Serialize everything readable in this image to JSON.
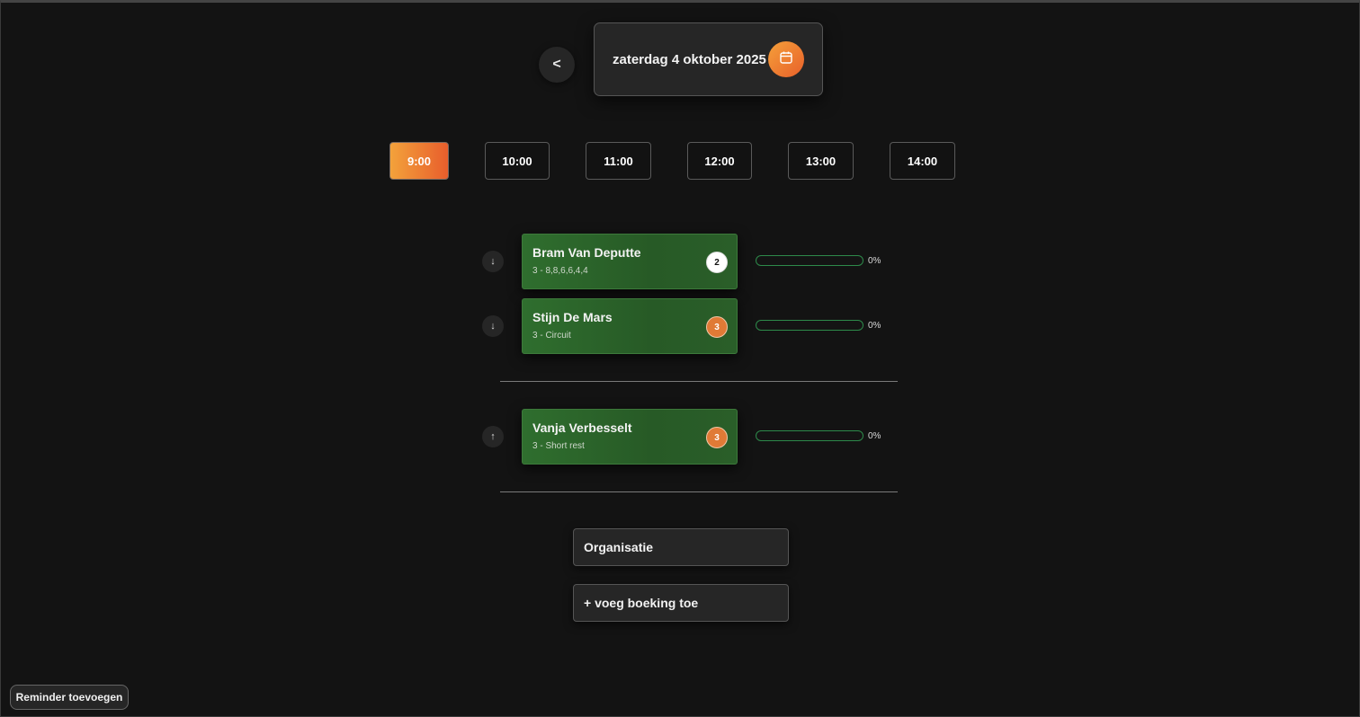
{
  "header": {
    "prev_label": "<",
    "date": "zaterdag 4 oktober 2025",
    "calendar_icon": "calendar-icon"
  },
  "time_slots": [
    {
      "label": "9:00",
      "active": true
    },
    {
      "label": "10:00",
      "active": false
    },
    {
      "label": "11:00",
      "active": false
    },
    {
      "label": "12:00",
      "active": false
    },
    {
      "label": "13:00",
      "active": false
    },
    {
      "label": "14:00",
      "active": false
    }
  ],
  "bookings": [
    {
      "arrow": "↓",
      "name": "Bram Van Deputte",
      "sub": "3 - 8,8,6,6,4,4",
      "badge": "2",
      "badge_color": "#ffffff",
      "progress": 0,
      "progress_label": "0%"
    },
    {
      "arrow": "↓",
      "name": "Stijn De Mars",
      "sub": "3 - Circuit",
      "badge": "3",
      "badge_color": "#e07a36",
      "progress": 0,
      "progress_label": "0%"
    },
    {
      "arrow": "↑",
      "name": "Vanja Verbesselt",
      "sub": "3 - Short rest",
      "badge": "3",
      "badge_color": "#e07a36",
      "progress": 0,
      "progress_label": "0%"
    }
  ],
  "actions": {
    "organisatie": "Organisatie",
    "add_booking": "+ voeg boeking toe",
    "reminder": "Reminder toevoegen"
  },
  "colors": {
    "accent_orange": "#e8602a",
    "booking_green": "#2f6e2e",
    "background": "#131313"
  }
}
